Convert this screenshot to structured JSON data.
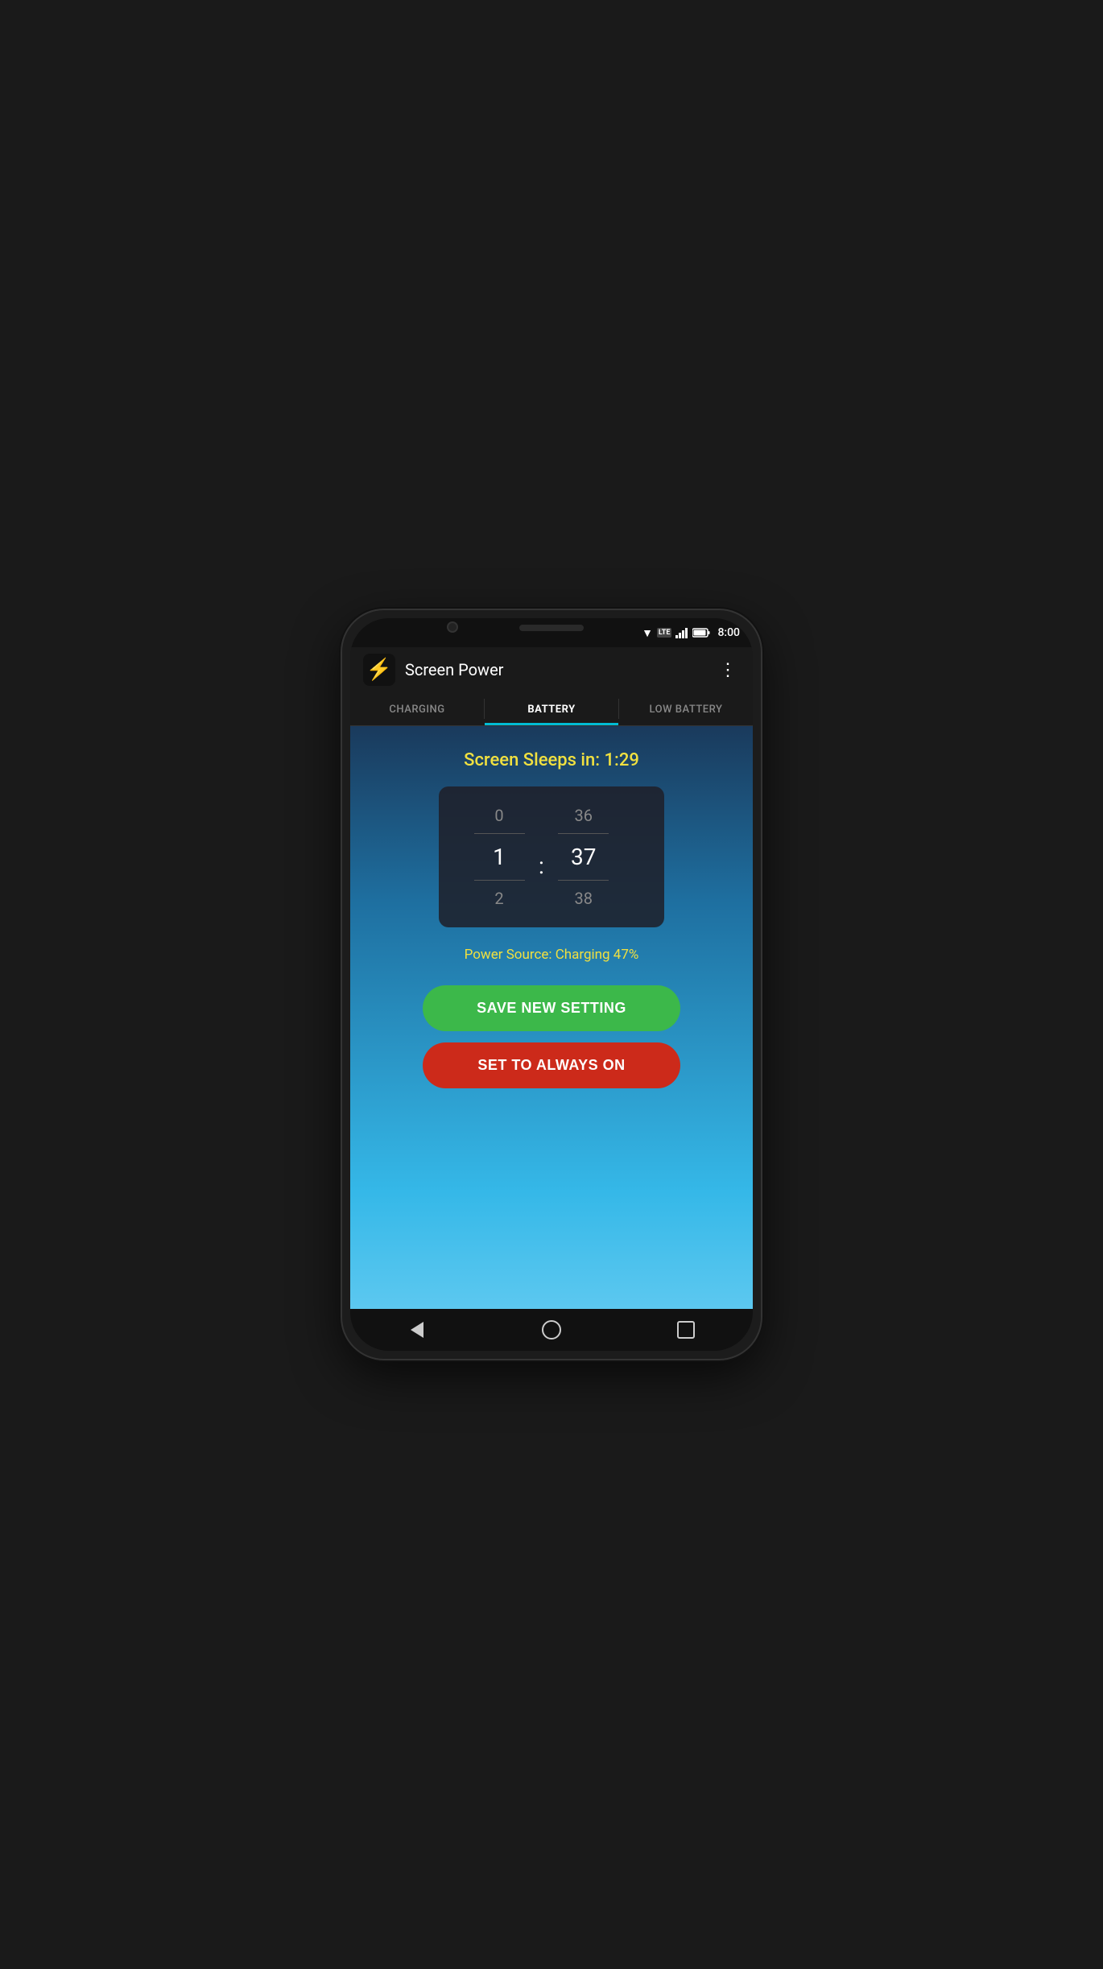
{
  "status_bar": {
    "time": "8:00",
    "lte": "LTE"
  },
  "app_bar": {
    "title": "Screen Power",
    "icon": "⚡",
    "menu_icon": "⋮"
  },
  "tabs": [
    {
      "id": "charging",
      "label": "CHARGING",
      "active": false
    },
    {
      "id": "battery",
      "label": "BATTERY",
      "active": true
    },
    {
      "id": "low-battery",
      "label": "LOW BATTERY",
      "active": false
    }
  ],
  "main": {
    "sleep_label": "Screen Sleeps in: 1:29",
    "picker": {
      "minutes_above": "0",
      "minutes_selected": "1",
      "minutes_below": "2",
      "seconds_above": "36",
      "seconds_selected": "37",
      "seconds_below": "38"
    },
    "power_source": "Power Source: Charging  47%",
    "save_button": "SAVE NEW SETTING",
    "always_on_button": "SET TO ALWAYS ON"
  },
  "nav_bar": {
    "back": "back",
    "home": "home",
    "recents": "recents"
  }
}
